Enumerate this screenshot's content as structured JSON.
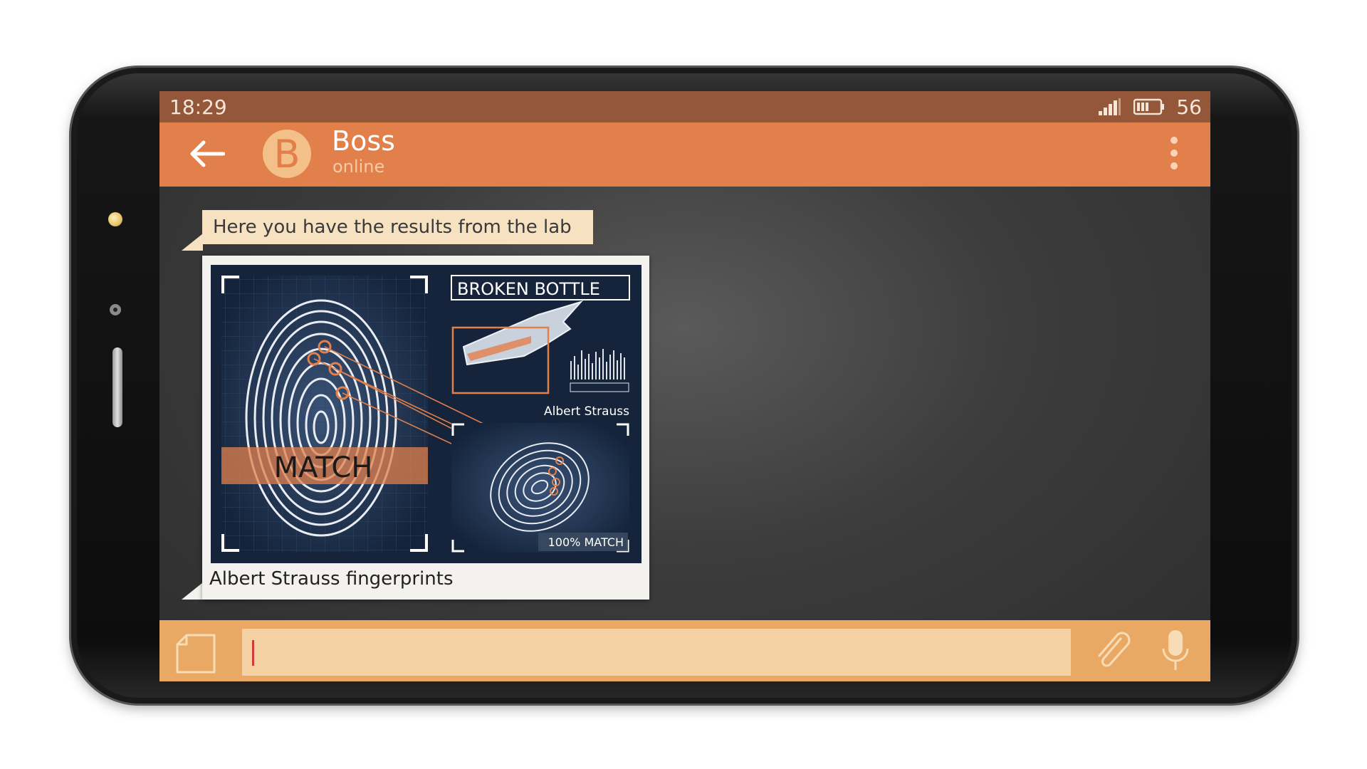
{
  "status_bar": {
    "time": "18:29",
    "battery_percent": "56",
    "signal_icon": "signal-icon",
    "battery_icon": "battery-icon"
  },
  "header": {
    "avatar_letter": "B",
    "contact_name": "Boss",
    "contact_status": "online",
    "back_icon": "arrow-left-icon",
    "menu_icon": "more-vertical-icon"
  },
  "messages": {
    "text_message": "Here you have the results from the lab",
    "image_caption": "Albert Strauss fingerprints",
    "lab_image": {
      "title": "BROKEN BOTTLE",
      "suspect_name": "Albert Strauss",
      "stamp": "MATCH",
      "match_label": "100% MATCH"
    }
  },
  "input_bar": {
    "sticker_icon": "sticker-icon",
    "attach_icon": "paperclip-icon",
    "mic_icon": "microphone-icon",
    "input_value": ""
  },
  "colors": {
    "status_bar": "#94573a",
    "header": "#e2804c",
    "input_bar": "#e9a965",
    "input_field": "#f4d2a3",
    "bubble": "#f6e1c0"
  }
}
